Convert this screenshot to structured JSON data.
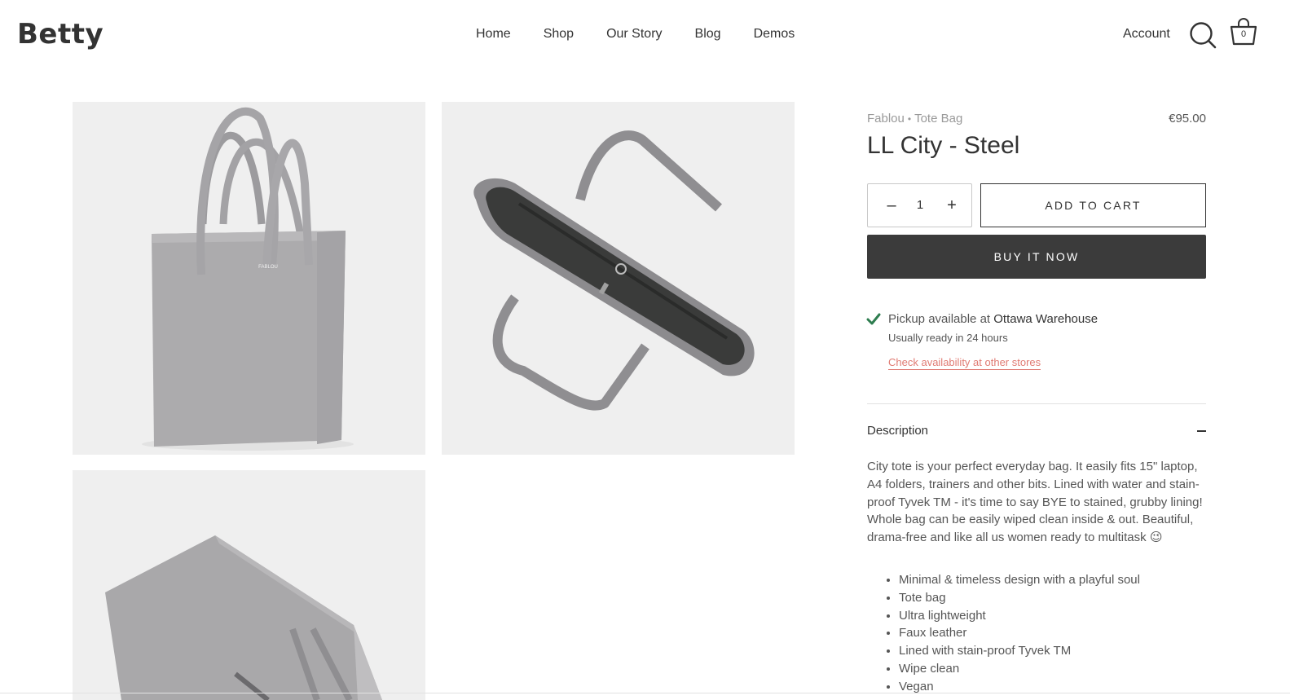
{
  "brand": {
    "logo_text": "Betty"
  },
  "nav": {
    "items": [
      {
        "label": "Home"
      },
      {
        "label": "Shop"
      },
      {
        "label": "Our Story"
      },
      {
        "label": "Blog"
      },
      {
        "label": "Demos"
      }
    ]
  },
  "header": {
    "account_label": "Account",
    "search_icon": "search-icon",
    "cart_icon": "cart-icon",
    "cart_count": "0"
  },
  "gallery": {
    "images": [
      {
        "icon": "tote-bag-front-image"
      },
      {
        "icon": "tote-bag-top-view-image"
      },
      {
        "icon": "tote-bag-angle-image"
      }
    ],
    "bag_logo_text": "FABLOU"
  },
  "product": {
    "vendor": "Fablou",
    "separator": "•",
    "type": "Tote Bag",
    "title": "LL City - Steel",
    "price": "€95.00",
    "quantity": "1",
    "add_to_cart_label": "ADD TO CART",
    "buy_now_label": "BUY IT NOW"
  },
  "pickup": {
    "prefix": "Pickup available at ",
    "location": "Ottawa Warehouse",
    "ready_text": "Usually ready in 24 hours",
    "link_text": "Check availability at other stores",
    "check_color": "#2e7d4f"
  },
  "description": {
    "heading": "Description",
    "text": "City tote is your perfect everyday bag. It easily fits 15\" laptop, A4 folders, trainers and other bits. Lined with water and stain-proof Tyvek TM - it's time to say BYE to stained, grubby lining! Whole bag can be easily wiped clean inside & out. Beautiful, drama-free and like all us women ready to multitask 😉",
    "features": [
      "Minimal & timeless design with a playful soul",
      "Tote bag",
      "Ultra lightweight",
      "Faux leather",
      "Lined with stain-proof Tyvek TM",
      "Wipe clean",
      "Vegan"
    ]
  },
  "colors": {
    "text": "#333333",
    "muted": "#999999",
    "button_dark": "#3b3b3b",
    "link_accent": "#e07b73",
    "image_bg": "#efefef",
    "bag_grey": "#a9a8aa"
  }
}
